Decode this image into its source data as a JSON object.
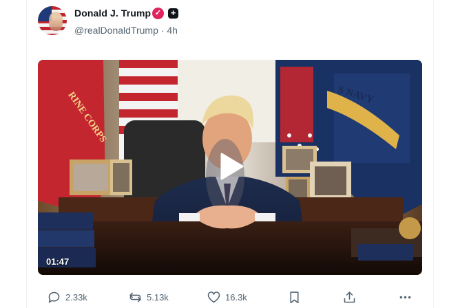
{
  "post": {
    "author_name": "Donald J. Trump",
    "verified_badge": "✓",
    "affiliation_badge": "+",
    "handle": "@realDonaldTrump",
    "separator": " · ",
    "time_ago": "4h",
    "video": {
      "duration": "01:47",
      "has_play_button": true,
      "flag_text_left": "RINE CORPS",
      "flag_text_right": "S NAVY"
    },
    "actions": {
      "replies": "2.33k",
      "reposts": "5.13k",
      "likes": "16.3k"
    }
  },
  "colors": {
    "text_primary": "#0f1419",
    "text_secondary": "#536471",
    "verified": "#e0245e"
  },
  "icons": [
    "reply-icon",
    "repost-icon",
    "like-icon",
    "bookmark-icon",
    "share-icon",
    "more-icon",
    "play-icon"
  ]
}
